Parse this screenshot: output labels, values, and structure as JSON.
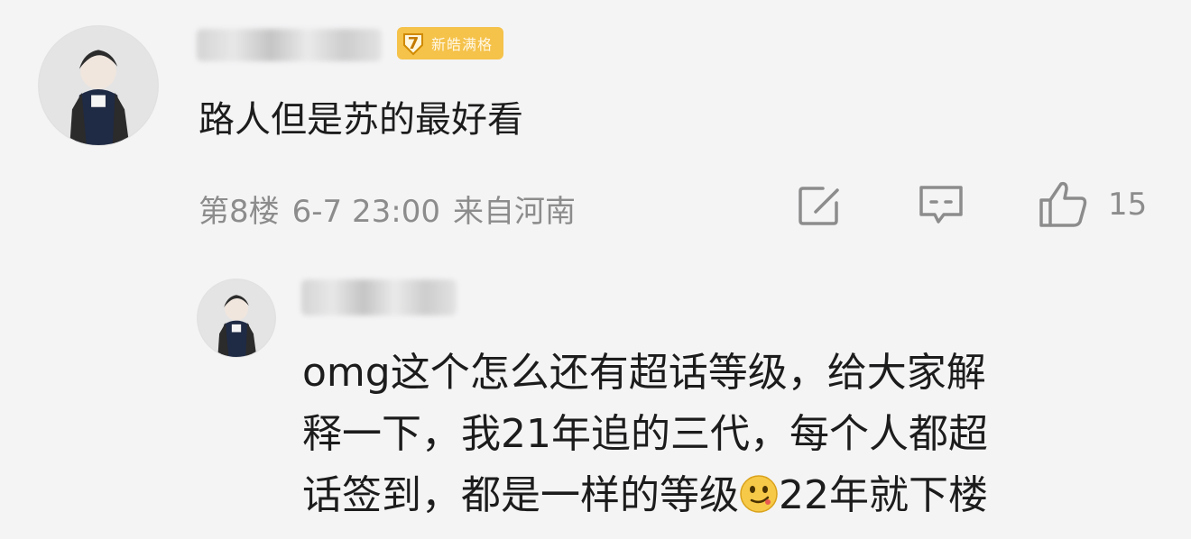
{
  "comment": {
    "badge": {
      "level": "7",
      "label": "新皓满格",
      "color": "#f5c24a"
    },
    "text": "路人但是苏的最好看",
    "meta": {
      "floor": "第8楼",
      "datetime": "6-7 23:00",
      "location": "来自河南"
    },
    "actions": {
      "repost_icon": "edit-square-icon",
      "comment_icon": "comment-bubble-icon",
      "like_icon": "thumbs-up-icon",
      "like_count": "15"
    }
  },
  "reply": {
    "lines": [
      "omg这个怎么还有超话等级，给大家解",
      "释一下，我21年追的三代，每个人都超"
    ],
    "line3_before_emoji": "话签到，都是一样的等级",
    "emoji": "smirk-emoji",
    "line3_after_emoji": "22年就下楼"
  },
  "colors": {
    "meta_gray": "#8c8c8c",
    "badge_yellow": "#f5c24a"
  }
}
